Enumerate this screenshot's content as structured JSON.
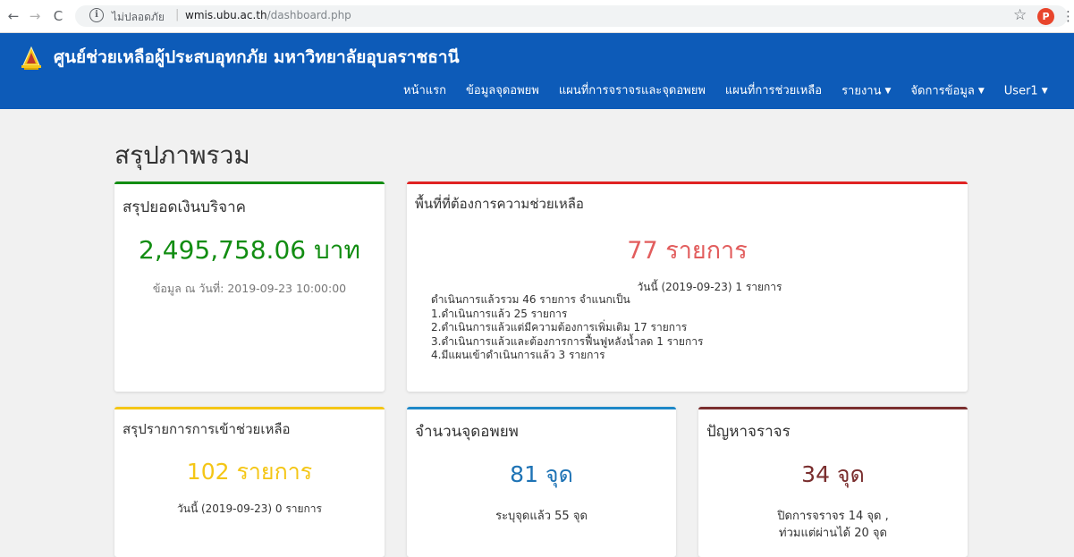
{
  "browser": {
    "security_label": "ไม่ปลอดภัย",
    "host": "wmis.ubu.ac.th",
    "path": "/dashboard.php",
    "avatar_letter": "P",
    "icons": [
      "back-arrow-icon",
      "forward-arrow-icon",
      "reload-icon",
      "info-icon",
      "star-icon",
      "menu-dots-icon"
    ]
  },
  "header": {
    "brand": "ศูนย์ช่วยเหลือผู้ประสบอุทกภัย มหาวิทยาลัยอุบลราชธานี",
    "nav": [
      {
        "label": "หน้าแรก",
        "dropdown": false
      },
      {
        "label": "ข้อมูลจุดอพยพ",
        "dropdown": false
      },
      {
        "label": "แผนที่การจราจรและจุดอพยพ",
        "dropdown": false
      },
      {
        "label": "แผนที่การช่วยเหลือ",
        "dropdown": false
      },
      {
        "label": "รายงาน",
        "dropdown": true
      },
      {
        "label": "จัดการข้อมูล",
        "dropdown": true
      },
      {
        "label": "User1",
        "dropdown": true
      }
    ]
  },
  "page": {
    "title": "สรุปภาพรวม"
  },
  "cards": {
    "donation": {
      "title": "สรุปยอดเงินบริจาค",
      "value": "2,495,758.06 บาท",
      "note": "ข้อมูล ณ วันที่: 2019-09-23 10:00:00"
    },
    "areas": {
      "title": "พื้นที่ที่ต้องการความช่วยเหลือ",
      "value": "77 รายการ",
      "today": "วันนี้ (2019-09-23) 1 รายการ",
      "details": [
        "ดำเนินการแล้วรวม 46 รายการ   จำแนกเป็น",
        "1.ดำเนินการแล้ว 25 รายการ",
        "2.ดำเนินการแล้วแต่มีความต้องการเพิ่มเติม 17 รายการ",
        "3.ดำเนินการแล้วและต้องการการฟื้นฟูหลังน้ำลด 1 รายการ",
        "4.มีแผนเข้าดำเนินการแล้ว 3 รายการ"
      ]
    },
    "assistance": {
      "title": "สรุปรายการการเข้าช่วยเหลือ",
      "value": "102 รายการ",
      "today": "วันนี้ (2019-09-23) 0 รายการ"
    },
    "evacuation": {
      "title": "จำนวนจุดอพยพ",
      "value": "81 จุด",
      "note": "ระบุจุดแล้ว 55 จุด"
    },
    "traffic": {
      "title": "ปัญหาจราจร",
      "value": "34 จุด",
      "note1": "ปิดการจราจร 14 จุด ,",
      "note2": "ท่วมแต่ผ่านได้ 20 จุด"
    }
  },
  "colors": {
    "navbar": "#0d5bb8",
    "donation": "#128d12",
    "areas": "#e25d5d",
    "assistance": "#f4c616",
    "evacuation": "#1e73b5",
    "traffic": "#7a2e2e"
  }
}
